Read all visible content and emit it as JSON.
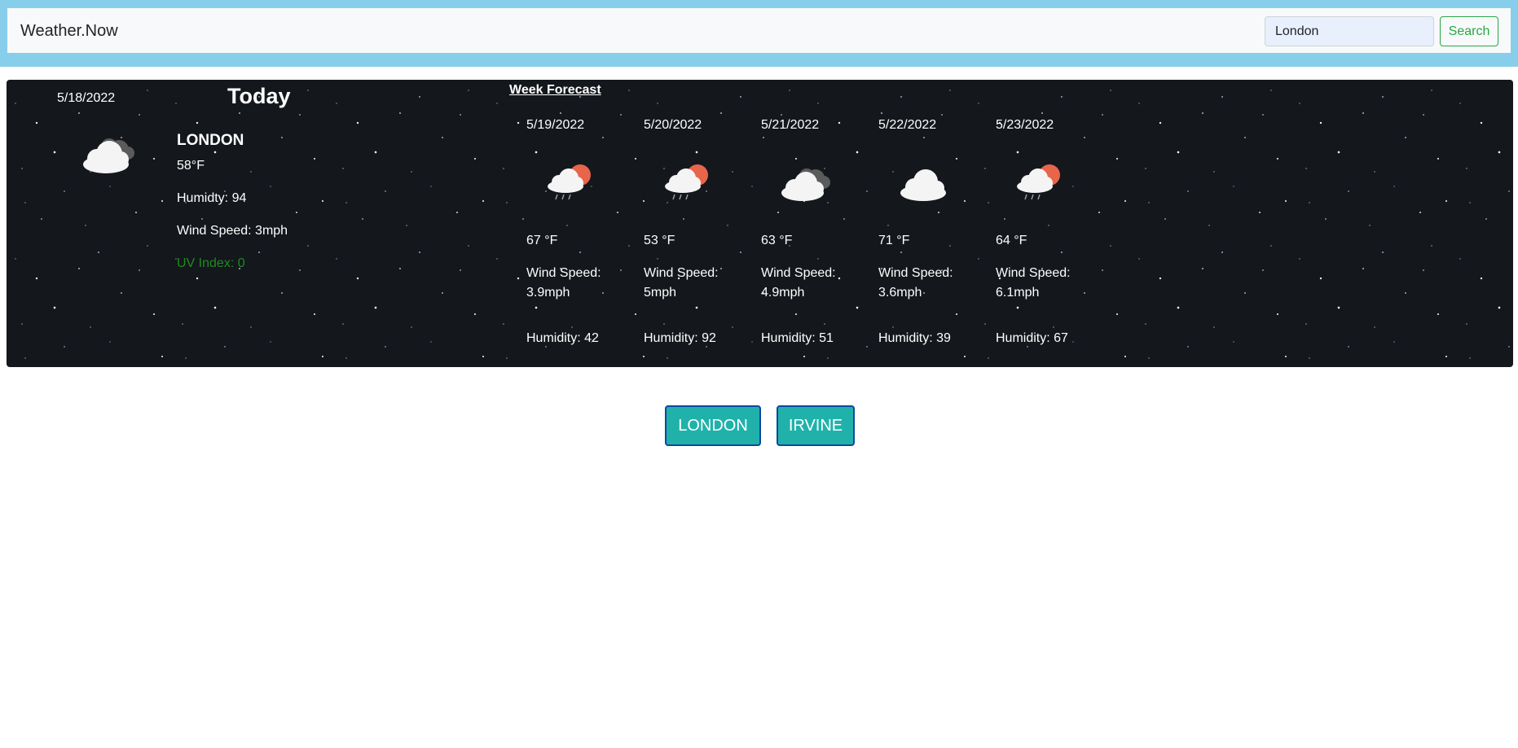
{
  "navbar": {
    "brand": "Weather.Now",
    "search": {
      "value": "London",
      "button_label": "Search"
    }
  },
  "today": {
    "date": "5/18/2022",
    "heading": "Today",
    "city": "LONDON",
    "temperature": "58°F",
    "humidity": "Humidty: 94",
    "wind_speed": "Wind Speed: 3mph",
    "uv_index": "UV Index: 0",
    "icon": "cloudy-icon"
  },
  "forecast": {
    "title": "Week Forecast",
    "days": [
      {
        "date": "5/19/2022",
        "temp": "67 °F",
        "wind": "Wind Speed: 3.9mph",
        "humidity": "Humidity: 42",
        "icon": "sun-cloud-rain-icon"
      },
      {
        "date": "5/20/2022",
        "temp": "53 °F",
        "wind": "Wind Speed: 5mph",
        "humidity": "Humidity: 92",
        "icon": "sun-cloud-rain-icon"
      },
      {
        "date": "5/21/2022",
        "temp": "63 °F",
        "wind": "Wind Speed: 4.9mph",
        "humidity": "Humidity: 51",
        "icon": "cloudy-icon"
      },
      {
        "date": "5/22/2022",
        "temp": "71 °F",
        "wind": "Wind Speed: 3.6mph",
        "humidity": "Humidity: 39",
        "icon": "cloud-icon"
      },
      {
        "date": "5/23/2022",
        "temp": "64 °F",
        "wind": "Wind Speed: 6.1mph",
        "humidity": "Humidity: 67",
        "icon": "sun-cloud-rain-icon"
      }
    ]
  },
  "history": [
    "LONDON",
    "IRVINE"
  ],
  "colors": {
    "header_band": "#87ceeb",
    "search_button": "#28a745",
    "uv_index": "#1f8b1f",
    "history_button": "#20b2aa",
    "history_border": "#0d47a1",
    "sun": "#e8654a"
  }
}
